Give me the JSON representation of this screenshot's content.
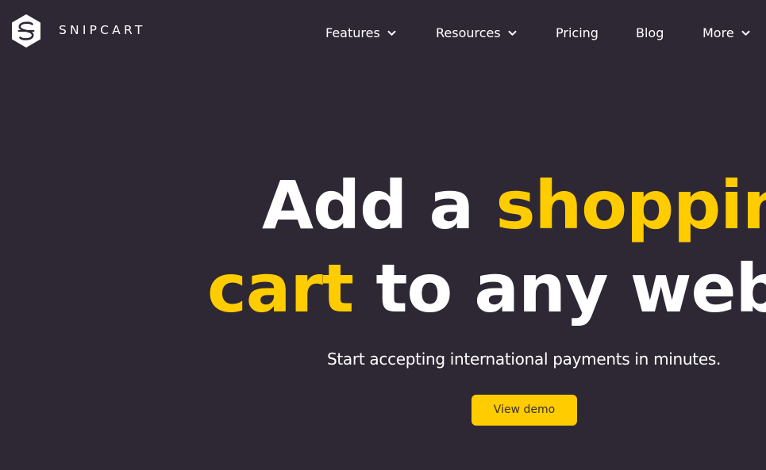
{
  "brand": {
    "name": "SNIPCART",
    "logo_icon": "snipcart-hexagon-s-icon"
  },
  "nav": {
    "items": [
      {
        "label": "Features",
        "has_dropdown": true
      },
      {
        "label": "Resources",
        "has_dropdown": true
      },
      {
        "label": "Pricing",
        "has_dropdown": false
      },
      {
        "label": "Blog",
        "has_dropdown": false
      },
      {
        "label": "More",
        "has_dropdown": true
      }
    ],
    "dropdown_icon": "chevron-down-icon"
  },
  "hero": {
    "line1": {
      "white": "Add a",
      "yellow": "shopping"
    },
    "line2": {
      "yellow": "cart",
      "white": "to any website"
    },
    "subtitle": "Start accepting international payments in minutes.",
    "cta_label": "View demo"
  },
  "colors": {
    "background": "#2e2834",
    "accent": "#ffcc00",
    "text": "#ffffff"
  }
}
